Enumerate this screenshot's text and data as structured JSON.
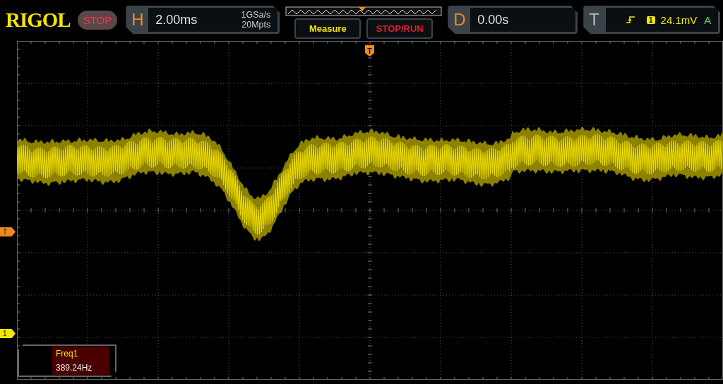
{
  "logo": "RIGOL",
  "run_state": {
    "label": "STOP"
  },
  "horizontal": {
    "letter": "H",
    "timebase": "2.00ms",
    "sample_rate": "1GSa/s",
    "memory_depth": "20Mpts"
  },
  "buttons": [
    {
      "label": "Measure",
      "kind": "measure"
    },
    {
      "label": "STOP/RUN",
      "kind": "stoprun"
    }
  ],
  "delay": {
    "letter": "D",
    "value": "0.00s"
  },
  "trigger": {
    "letter": "T",
    "source": "1",
    "level": "24.1mV",
    "mode": "A"
  },
  "markers": {
    "trigger_position": "T",
    "trigger_level": "T",
    "channel": "1"
  },
  "measurement": {
    "name": "Freq1",
    "value": "389.24Hz"
  }
}
